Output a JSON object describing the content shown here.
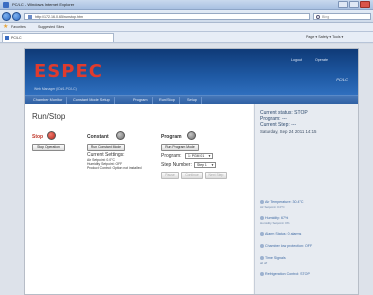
{
  "browser": {
    "title": "PC/LC - Windows Internet Explorer",
    "url": "http://172.16.0.65/runstop.htm",
    "search_placeholder": "Bing",
    "favorites_label": "Favorites",
    "suggested_sites": "Suggested Sites",
    "tab_label": "PC/LC",
    "command_bar": "Page ▾  Safety ▾  Tools ▾"
  },
  "header": {
    "logo": "ESPEC",
    "link_logout": "Logout",
    "link_operate": "Operate",
    "unit_label": "PC/LC",
    "user_line": "Web Manager (ID#1-PC/LC)"
  },
  "menu": {
    "items": [
      "Chamber Monitor",
      "Constant Mode Setup",
      "Program",
      "Run/Stop",
      "Setup"
    ]
  },
  "main": {
    "title": "Run/Stop",
    "stop": {
      "heading": "Stop",
      "button": "Stop Operation"
    },
    "constant": {
      "heading": "Constant",
      "button": "Run Constant Mode",
      "settings_title": "Current Settings:",
      "line1": "Air Setpoint: 0.0°C",
      "line2": "Humidity Setpoint: OFF",
      "line3": "Product Control: Option not installed"
    },
    "program": {
      "heading": "Program",
      "button": "Run Program Mode",
      "program_label": "Program:",
      "program_value": "1: PGM 01",
      "step_label": "Step Number:",
      "step_value": "Step 1",
      "btn_pause": "Pause",
      "btn_continue": "Continue",
      "btn_nextstep": "Next Step"
    }
  },
  "side": {
    "status_line": "Current status: STOP",
    "program_line": "Program: ---",
    "step_line": "Current Step: ---",
    "date_line": "Saturday, Sep 24 2011 14:15",
    "items": [
      {
        "label": "Air Temperature: 30.4°C",
        "sub": "Air Setpoint: 0.0°C"
      },
      {
        "label": "Humidity: 67%",
        "sub": "Humidity Setpoint: 0%"
      },
      {
        "label": "Alarm Status: 0 alarms",
        "sub": ""
      },
      {
        "label": "Chamber low protection: OFF",
        "sub": ""
      },
      {
        "label": "Time Signals",
        "sub": "all off"
      },
      {
        "label": "Refrigeration Control: STOP",
        "sub": ""
      }
    ]
  },
  "colors": {
    "header_blue": "#1f5aa5",
    "logo_red": "#e03b2e",
    "stop_red": "#c0392b"
  }
}
